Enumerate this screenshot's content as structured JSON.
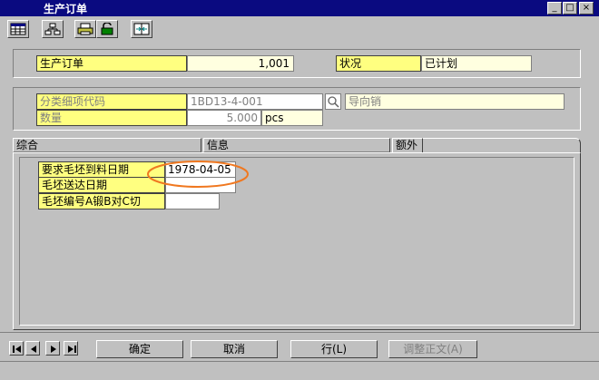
{
  "window": {
    "title": "生产订单",
    "min": "_",
    "max": "□",
    "close": "×"
  },
  "header": {
    "order_label": "生产订单",
    "order_value": "1,001",
    "status_label": "状况",
    "status_value": "已计划"
  },
  "item": {
    "code_label": "分类细项代码",
    "code_value": "1BD13-4-001",
    "name_value": "导向销",
    "qty_label": "数量",
    "qty_value": "5.000",
    "qty_unit": "pcs"
  },
  "tabs": [
    "综合",
    "信息",
    "额外"
  ],
  "extra": {
    "rows": [
      {
        "label": "要求毛坯到料日期",
        "value": "1978-04-05"
      },
      {
        "label": "毛坯送达日期",
        "value": ""
      },
      {
        "label": "毛坯编号A锻B对C切",
        "value": ""
      }
    ]
  },
  "buttons": {
    "ok": "确定",
    "cancel": "取消",
    "row": "行(L)",
    "adjust": "调整正文(A)"
  },
  "colors": {
    "title_bar": "#0a0a80",
    "highlight_circle": "#f07820",
    "label_bg": "#ffff80"
  }
}
